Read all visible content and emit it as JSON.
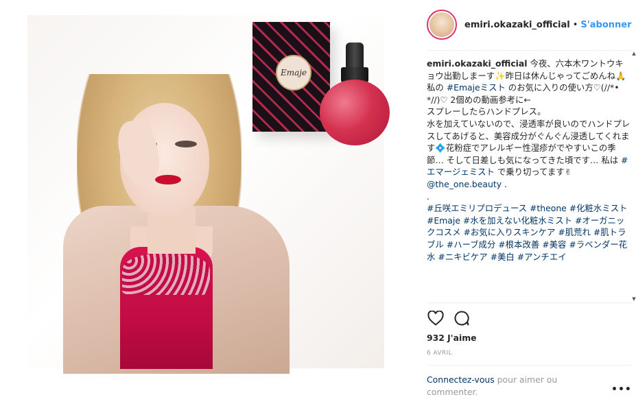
{
  "post": {
    "username": "emiri.okazaki_official",
    "separator": "•",
    "follow_label": "S'abonner",
    "product_label": "Emaje"
  },
  "caption": {
    "username": "emiri.okazaki_official",
    "text_1": "今夜、六本木ワントウキョウ出勤しまーす",
    "text_2": "昨日は休んじゃってごめんね",
    "text_3": " 私の ",
    "tag_emaje_mist": "#Emajeミスト",
    "text_4": " のお気に入りの使い方♡(//*•*//)♡ 2個めの動画参考に←",
    "line_spray": "スプレーしたらハンドプレス。",
    "line_water": "水を加えていないので、浸透率が良いのでハンドプレスしてあげると、美容成分がぐんぐん浸透してくれます",
    "line_pollen": "花粉症でアレルギー性湿疹がでやすいこの季節… そして日差しも気になってきた頃です… 私は ",
    "tag_emaje_mist2": "#エマージェミスト",
    "line_end": " で乗り切ってます",
    "mention": "@the_one.beauty",
    "mention_suffix": " .",
    "dot": ".",
    "tags": [
      "#丘咲エミリプロデュース",
      "#theone",
      "#化粧水ミスト",
      "#Emaje",
      "#水を加えない化粧水ミスト",
      "#オーガニックコスメ",
      "#お気に入りスキンケア",
      "#肌荒れ",
      "#肌トラブル",
      "#ハーブ成分",
      "#根本改善",
      "#美容",
      "#ラベンダー花水",
      "#ニキビケア",
      "#美白",
      "#アンチエイ"
    ]
  },
  "likes_text": "932 J'aime",
  "date": "6 AVRIL",
  "login": {
    "link": "Connectez-vous",
    "text": " pour aimer ou commenter."
  },
  "more_label": "•••",
  "colors": {
    "link_blue": "#3897f0",
    "tag_blue": "#003569",
    "dress_red": "#c10c44"
  }
}
